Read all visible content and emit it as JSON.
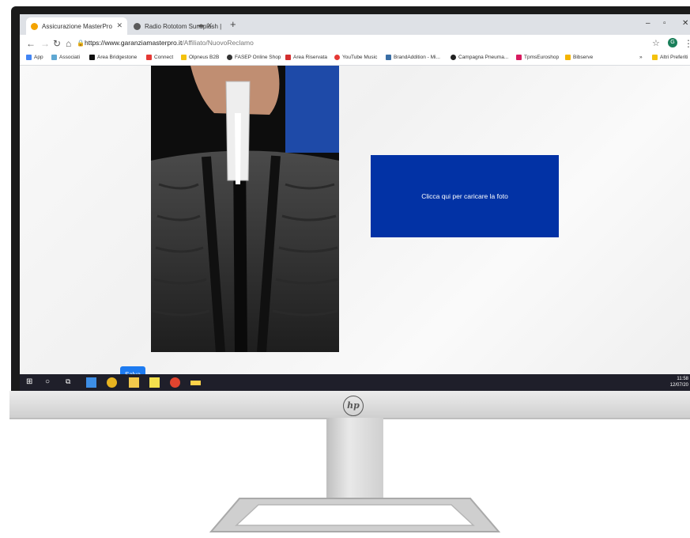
{
  "browser": {
    "tabs": [
      {
        "title": "Assicurazione MasterPro",
        "active": true
      },
      {
        "title": "Radio Rototom Sunsplash |",
        "active": false
      }
    ],
    "address": {
      "host": "https://www.garanziamasterpro.it",
      "path": "/Affiliato/NuovoReclamo"
    },
    "bookmarks": [
      {
        "label": "App",
        "color": "#4285f4"
      },
      {
        "label": "Associati",
        "color": "#5fa8d3"
      },
      {
        "label": "Area Bridgestone",
        "color": "#111111"
      },
      {
        "label": "Connect",
        "color": "#e53935"
      },
      {
        "label": "Olpneus B2B",
        "color": "#f4c20d"
      },
      {
        "label": "FASEP Online Shop",
        "color": "#333333"
      },
      {
        "label": "Area Riservata",
        "color": "#d32f2f"
      },
      {
        "label": "YouTube Music",
        "color": "#e53935"
      },
      {
        "label": "BrandAddition - Mi...",
        "color": "#3a6ea5"
      },
      {
        "label": "Campagna Pneuma...",
        "color": "#222222"
      },
      {
        "label": "TpmsEuroshop",
        "color": "#d81b60"
      },
      {
        "label": "Bibserve",
        "color": "#f4b400"
      },
      {
        "label": "Altri Preferiti",
        "color": "#f4c20d"
      }
    ],
    "profile_initial": "G"
  },
  "page": {
    "upload_button": "Clicca qui per caricare la foto",
    "save_button": "Salva"
  },
  "taskbar": {
    "time": "11:58",
    "date": "12/07/20"
  },
  "colors": {
    "upload_bg": "#0232a5",
    "save_bg": "#1e7bf0"
  }
}
